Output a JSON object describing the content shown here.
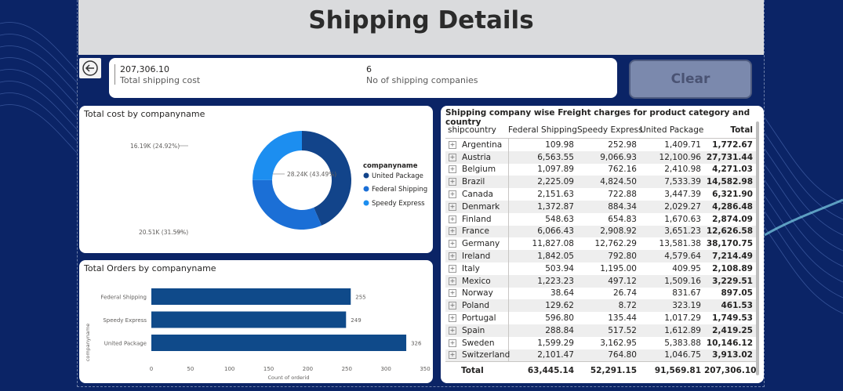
{
  "header": {
    "title": "Shipping Details"
  },
  "kpis": {
    "cost_value": "207,306.10",
    "cost_label": "Total shipping cost",
    "companies_value": "6",
    "companies_label": "No of shipping companies"
  },
  "clear_button": {
    "label": "Clear"
  },
  "icons": {
    "back": "back-arrow-icon",
    "expand": "expand-plus-icon"
  },
  "colors": {
    "united_package": "#12448a",
    "federal_shipping": "#1b6fd6",
    "speedy_express": "#1c8ef0",
    "bar": "#0f4a8a"
  },
  "chart_data": [
    {
      "type": "pie",
      "title": "Total cost by companyname",
      "legend_title": "companyname",
      "legend_position": "right",
      "slices": [
        {
          "name": "United Package",
          "value": 28.24,
          "label": "28.24K (43.49%)",
          "percent": 43.49,
          "color": "#12448a"
        },
        {
          "name": "Federal Shipping",
          "value": 20.51,
          "label": "20.51K (31.59%)",
          "percent": 31.59,
          "color": "#1b6fd6"
        },
        {
          "name": "Speedy Express",
          "value": 16.19,
          "label": "16.19K (24.92%)",
          "percent": 24.92,
          "color": "#1c8ef0"
        }
      ]
    },
    {
      "type": "bar",
      "orientation": "horizontal",
      "title": "Total Orders by companyname",
      "categories": [
        "Federal Shipping",
        "Speedy Express",
        "United Package"
      ],
      "values": [
        255,
        249,
        326
      ],
      "xlabel": "Count of orderid",
      "ylabel": "companyname",
      "xlim": [
        0,
        350
      ],
      "xticks": [
        "0",
        "50",
        "100",
        "150",
        "200",
        "250",
        "300",
        "350"
      ],
      "grid": false
    }
  ],
  "table": {
    "title": "Shipping company wise Freight charges for product category and country",
    "columns": [
      "shipcountry",
      "Federal Shipping",
      "Speedy Express",
      "United Package",
      "Total"
    ],
    "rows": [
      [
        "Argentina",
        "109.98",
        "252.98",
        "1,409.71",
        "1,772.67"
      ],
      [
        "Austria",
        "6,563.55",
        "9,066.93",
        "12,100.96",
        "27,731.44"
      ],
      [
        "Belgium",
        "1,097.89",
        "762.16",
        "2,410.98",
        "4,271.03"
      ],
      [
        "Brazil",
        "2,225.09",
        "4,824.50",
        "7,533.39",
        "14,582.98"
      ],
      [
        "Canada",
        "2,151.63",
        "722.88",
        "3,447.39",
        "6,321.90"
      ],
      [
        "Denmark",
        "1,372.87",
        "884.34",
        "2,029.27",
        "4,286.48"
      ],
      [
        "Finland",
        "548.63",
        "654.83",
        "1,670.63",
        "2,874.09"
      ],
      [
        "France",
        "6,066.43",
        "2,908.92",
        "3,651.23",
        "12,626.58"
      ],
      [
        "Germany",
        "11,827.08",
        "12,762.29",
        "13,581.38",
        "38,170.75"
      ],
      [
        "Ireland",
        "1,842.05",
        "792.80",
        "4,579.64",
        "7,214.49"
      ],
      [
        "Italy",
        "503.94",
        "1,195.00",
        "409.95",
        "2,108.89"
      ],
      [
        "Mexico",
        "1,223.23",
        "497.12",
        "1,509.16",
        "3,229.51"
      ],
      [
        "Norway",
        "38.64",
        "26.74",
        "831.67",
        "897.05"
      ],
      [
        "Poland",
        "129.62",
        "8.72",
        "323.19",
        "461.53"
      ],
      [
        "Portugal",
        "596.80",
        "135.44",
        "1,017.29",
        "1,749.53"
      ],
      [
        "Spain",
        "288.84",
        "517.52",
        "1,612.89",
        "2,419.25"
      ],
      [
        "Sweden",
        "1,599.29",
        "3,162.95",
        "5,383.88",
        "10,146.12"
      ],
      [
        "Switzerland",
        "2,101.47",
        "764.80",
        "1,046.75",
        "3,913.02"
      ]
    ],
    "total_row": [
      "Total",
      "63,445.14",
      "52,291.15",
      "91,569.81",
      "207,306.10"
    ]
  }
}
